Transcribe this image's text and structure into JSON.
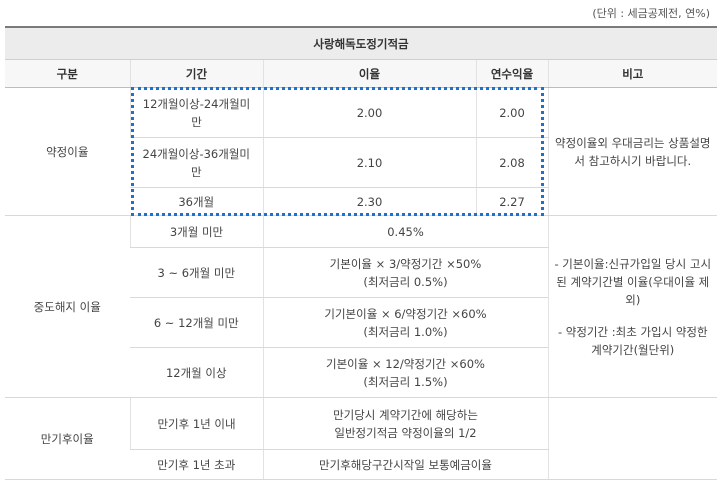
{
  "unit_note": "(단위 : 세금공제전, 연%)",
  "title": "사랑해독도정기적금",
  "headers": [
    "구분",
    "기간",
    "이율",
    "연수익율",
    "비고"
  ],
  "sections": {
    "contract": {
      "label": "약정이율",
      "rows": [
        {
          "period": "12개월이상-24개월미만",
          "rate": "2.00",
          "annual_yield": "2.00"
        },
        {
          "period": "24개월이상-36개월미만",
          "rate": "2.10",
          "annual_yield": "2.08"
        },
        {
          "period": "36개월",
          "rate": "2.30",
          "annual_yield": "2.27"
        }
      ],
      "note": "약정이율외 우대금리는 상품설명서 참고하시기 바랍니다."
    },
    "early": {
      "label": "중도해지 이율",
      "rows": [
        {
          "period": "3개월 미만",
          "rate_line1": "0.45%",
          "rate_line2": ""
        },
        {
          "period": "3 ~ 6개월 미만",
          "rate_line1": "기본이율 × 3/약정기간 ×50%",
          "rate_line2": "(최저금리 0.5%)"
        },
        {
          "period": "6 ~ 12개월 미만",
          "rate_line1": "기기본이율 × 6/약정기간 ×60%",
          "rate_line2": "(최저금리 1.0%)"
        },
        {
          "period": "12개월 이상",
          "rate_line1": "기본이율 × 12/약정기간 ×60%",
          "rate_line2": "(최저금리 1.5%)"
        }
      ],
      "note1": "- 기본이율:신규가입일 당시 고시된 계약기간별 이율(우대이율 제외)",
      "note2": "- 약정기간 :최초 가입시 약정한 계약기간(월단위)"
    },
    "maturity": {
      "label": "만기후이율",
      "rows": [
        {
          "period": "만기후 1년 이내",
          "rate_line1": "만기당시 계약기간에 해당하는",
          "rate_line2": "일반정기적금 약정이율의 1/2"
        },
        {
          "period": "만기후 1년 초과",
          "rate_line1": "만기후해당구간시작일 보통예금이율",
          "rate_line2": ""
        }
      ]
    }
  }
}
